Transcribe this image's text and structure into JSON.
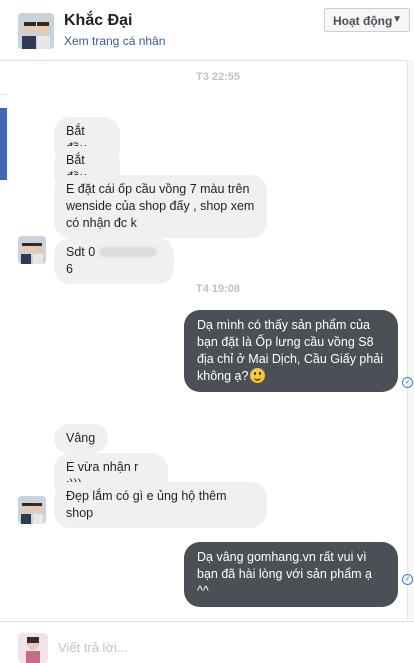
{
  "header": {
    "contact_name": "Khắc Đại",
    "profile_link": "Xem trang cá nhân",
    "status_button": "Hoạt động"
  },
  "icons": {
    "avatar": "avatar-photo",
    "status_caret": "chevron-down-icon",
    "seen": "check-circle-icon",
    "emoji": "smiley-emoji-icon"
  },
  "colors": {
    "incoming_bubble": "#f1f0f0",
    "outgoing_bubble": "#4b4f56",
    "link": "#365899",
    "seen_check": "#3b7fd8"
  },
  "messages": {
    "ts1": "T3 22:55",
    "m1": "Bắt đầu",
    "m2": "Bắt đầu",
    "m3": "E đặt cái ốp cầu vồng 7 màu trên wenside của shop đấy , shop xem có nhận đc k",
    "m4": "Sdt 0",
    "m4_tail": "6",
    "ts2": "T4 19:08",
    "m5": "Dạ mình có thấy sản phẩm của bạn đặt là Ốp lưng cầu vồng S8 địa chỉ ở Mai Dịch, Cầu Giấy phải không ạ?",
    "m6": "Vâng",
    "m7": "E vừa nhận r :)))",
    "m8": "Đẹp lắm có gì e ủng hộ thêm shop",
    "m9": "Dạ vâng gomhang.vn rất vui vì bạn đã hài lòng với sản phẩm ạ ^^"
  },
  "composer": {
    "placeholder": "Viết trả lời..."
  }
}
